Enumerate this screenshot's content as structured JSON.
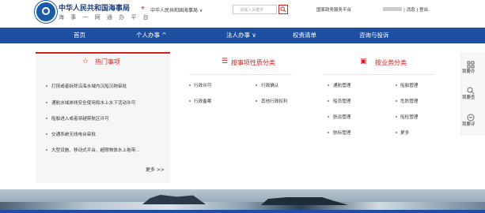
{
  "header": {
    "title": "中华人民共和国海事局",
    "subtitle": "海 事 一 网 通 办 平 台",
    "region": "中华人民共和国海事局 ∨",
    "search_placeholder": "请输入关键字",
    "portal_label": "国家政务服务平台",
    "links": "| 消息 | 登出"
  },
  "nav": {
    "home": "首页",
    "personal": "个人办事 ^",
    "legal": "法人办事 ∨",
    "authority": "权责清单",
    "consult": "咨询与投诉"
  },
  "hot": {
    "title": "热门事项",
    "items": [
      "打捞或者拆除沿海水域内沉船沉物审批",
      "通航水域岸线安全使用和水上水下活动许可",
      "船舶进入或者穿越禁航区许可",
      "交通系统无线电台审批",
      "大型设施、移动式平台、超限物体水上拖带..."
    ],
    "more": "更多 >>"
  },
  "nature": {
    "title": "按事项性质分类",
    "items": [
      "行政许可",
      "行政确认",
      "行政备案",
      "其他行政权利"
    ]
  },
  "business": {
    "title": "按业务分类",
    "items": [
      "通航管理",
      "船舶管理",
      "船员管理",
      "危防管理",
      "航运管理",
      "船检管理",
      "航标管理",
      "更多"
    ]
  },
  "sidebar": {
    "items": [
      "我要办",
      "我要查",
      "我要评"
    ]
  },
  "colors": {
    "nav": "#1e4fa0",
    "accent": "#d62020"
  }
}
